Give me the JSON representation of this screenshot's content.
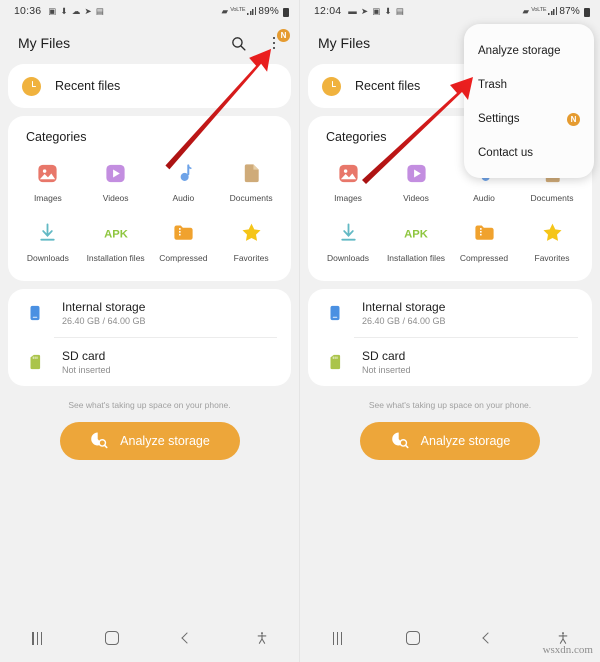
{
  "screens": [
    {
      "id": "screen-left",
      "status_bar": {
        "time": "10:36",
        "left_icons": [
          "message-icon",
          "download-icon",
          "cloud-icon",
          "telegram-icon",
          "image-icon"
        ],
        "wifi_icon": "wifi-icon",
        "network_label": "VoLTE",
        "signal_icon": "signal-icon",
        "battery_percent": "89%"
      },
      "appbar": {
        "title": "My Files",
        "search_icon": "search-icon",
        "menu_icon": "more-options-icon",
        "menu_badge": "N"
      },
      "menu_open": false
    },
    {
      "id": "screen-right",
      "status_bar": {
        "time": "12:04",
        "left_icons": [
          "message-icon",
          "telegram-icon",
          "chat-icon",
          "download-icon",
          "image-icon"
        ],
        "wifi_icon": "wifi-icon",
        "network_label": "VoLTE",
        "signal_icon": "signal-icon",
        "battery_percent": "87%"
      },
      "appbar": {
        "title": "My Files",
        "search_icon": "search-icon",
        "menu_icon": "more-options-icon",
        "menu_badge": "N"
      },
      "menu_open": true
    }
  ],
  "overflow_menu": {
    "items": [
      {
        "label": "Analyze storage",
        "badge": ""
      },
      {
        "label": "Trash",
        "badge": ""
      },
      {
        "label": "Settings",
        "badge": "N"
      },
      {
        "label": "Contact us",
        "badge": ""
      }
    ]
  },
  "recent": {
    "label": "Recent files",
    "icon": "clock-icon"
  },
  "categories": {
    "title": "Categories",
    "items": [
      {
        "label": "Images",
        "icon": "image-category-icon",
        "color": "#e8776a"
      },
      {
        "label": "Videos",
        "icon": "video-category-icon",
        "color": "#c38ee0"
      },
      {
        "label": "Audio",
        "icon": "audio-category-icon",
        "color": "#6ea3e8"
      },
      {
        "label": "Documents",
        "icon": "document-category-icon",
        "color": "#cfab79"
      },
      {
        "label": "Downloads",
        "icon": "download-category-icon",
        "color": "#62b9c4"
      },
      {
        "label": "Installation files",
        "icon": "apk-category-icon",
        "color": "#8ec63f"
      },
      {
        "label": "Compressed",
        "icon": "compressed-category-icon",
        "color": "#f0a22e"
      },
      {
        "label": "Favorites",
        "icon": "favorites-category-icon",
        "color": "#f5c518"
      }
    ]
  },
  "storage": {
    "rows": [
      {
        "title": "Internal storage",
        "subtitle": "26.40 GB / 64.00 GB",
        "icon": "internal-storage-icon",
        "color": "#4a90e2"
      },
      {
        "title": "SD card",
        "subtitle": "Not inserted",
        "icon": "sd-card-icon",
        "color": "#aac44a"
      }
    ]
  },
  "analyze": {
    "hint": "See what's taking up space on your phone.",
    "button_label": "Analyze storage",
    "button_icon": "storage-analyze-icon",
    "button_color": "#eda63a"
  },
  "navbar": {
    "items": [
      {
        "name": "recents-button",
        "icon": "recents-icon"
      },
      {
        "name": "home-button",
        "icon": "home-icon"
      },
      {
        "name": "back-button",
        "icon": "back-icon"
      },
      {
        "name": "accessibility-button",
        "icon": "accessibility-icon"
      }
    ]
  },
  "annotations": {
    "arrow_color": "#d81e1e",
    "arrows": [
      {
        "name": "arrow-to-more-options",
        "target": "more-options-icon"
      },
      {
        "name": "arrow-to-trash",
        "target": "Trash"
      }
    ]
  },
  "watermark": "wsxdn.com"
}
